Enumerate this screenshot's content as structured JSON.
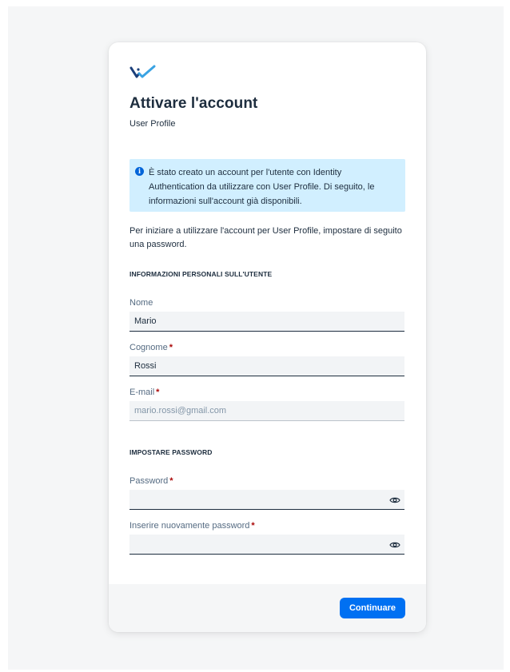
{
  "header": {
    "title": "Attivare l'account",
    "subtitle": "User Profile"
  },
  "info": {
    "icon": "info-icon",
    "text": "È stato creato un account per l'utente con Identity Authentication da utilizzare con User Profile. Di seguito, le informazioni sull'account già disponibili."
  },
  "intro": "Per iniziare a utilizzare l'account per User Profile, impostare di seguito una password.",
  "personal": {
    "section_title": "INFORMAZIONI PERSONALI SULL'UTENTE",
    "first_name": {
      "label": "Nome",
      "value": "Mario"
    },
    "last_name": {
      "label": "Cognome",
      "value": "Rossi",
      "required_mark": "*"
    },
    "email": {
      "label": "E-mail",
      "placeholder": "mario.rossi@gmail.com",
      "required_mark": "*"
    }
  },
  "password_section": {
    "section_title": "IMPOSTARE PASSWORD",
    "password": {
      "label": "Password",
      "value": "",
      "required_mark": "*"
    },
    "confirm": {
      "label": "Inserire nuovamente password",
      "value": "",
      "required_mark": "*"
    }
  },
  "footer": {
    "continue_label": "Continuare"
  },
  "colors": {
    "accent": "#0070f2",
    "info_background": "#d1efff",
    "required": "#aa0808"
  }
}
